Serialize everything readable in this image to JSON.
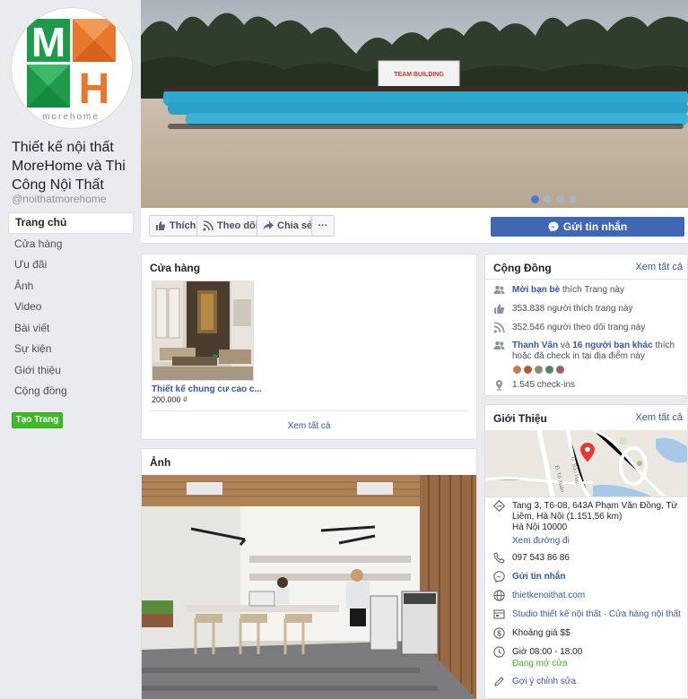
{
  "page": {
    "name": "Thiết kế nội thất MoreHome và Thi Công Nội Thất",
    "handle": "@noithatmorehome",
    "logo_text": "morehome"
  },
  "nav": {
    "items": [
      {
        "label": "Trang chủ",
        "active": true
      },
      {
        "label": "Cửa hàng"
      },
      {
        "label": "Ưu đãi"
      },
      {
        "label": "Ảnh"
      },
      {
        "label": "Video"
      },
      {
        "label": "Bài viết"
      },
      {
        "label": "Sự kiện"
      },
      {
        "label": "Giới thiệu"
      },
      {
        "label": "Cộng đồng"
      }
    ],
    "create_label": "Tạo Trang"
  },
  "cover": {
    "banner_text": "TEAM BUILDING"
  },
  "actions": {
    "like": "Thích",
    "follow": "Theo dõi",
    "share": "Chia sẻ",
    "more": "···",
    "message": "Gửi tin nhắn"
  },
  "shop": {
    "title": "Cửa hàng",
    "product_name": "Thiết kế chung cư cao c...",
    "product_price": "200.000 ₫",
    "see_all": "Xem tất cả"
  },
  "photos": {
    "title": "Ảnh"
  },
  "community": {
    "title": "Cộng Đồng",
    "see_all": "Xem tất cả",
    "invite_link": "Mời bạn bè",
    "invite_rest": " thích Trang này",
    "likes": "353.838 người thích trang này",
    "follows": "352.546 người theo dõi trang này",
    "friend_name": "Thanh Vân",
    "friend_and": " và ",
    "friend_count": "16 người bạn khác",
    "friend_rest": " thích hoặc đã check in tại địa điểm này",
    "checkins": "1.545 check-ins"
  },
  "about": {
    "title": "Giới Thiệu",
    "see_all": "Xem tất cả",
    "map_streets": [
      "Đ. Tố Xuân",
      "Đ. Bảo Huy"
    ],
    "address": "Tang 3, T6-08, 643A Phạm Văn Đồng, Từ Liêm, Hà Nội (1.151,56 km)",
    "address_line3": "Hà Nội 10000",
    "directions": "Xem đường đi",
    "phone": "097 543 86 86",
    "message": "Gửi tin nhắn",
    "website": "thietkenoithat.com",
    "category": "Studio thiết kế nội thất · Cửa hàng nội thất",
    "price": "Khoảng giá $$",
    "hours": "Giờ 08:00 - 18:00",
    "open_now": "Đang mở cửa",
    "suggest": "Gợi ý chỉnh sửa"
  },
  "colors": {
    "brand_blue": "#4267b2",
    "link": "#365899",
    "green": "#42b72a",
    "logo_green": "#1e9a4a",
    "logo_orange": "#e8772e"
  }
}
